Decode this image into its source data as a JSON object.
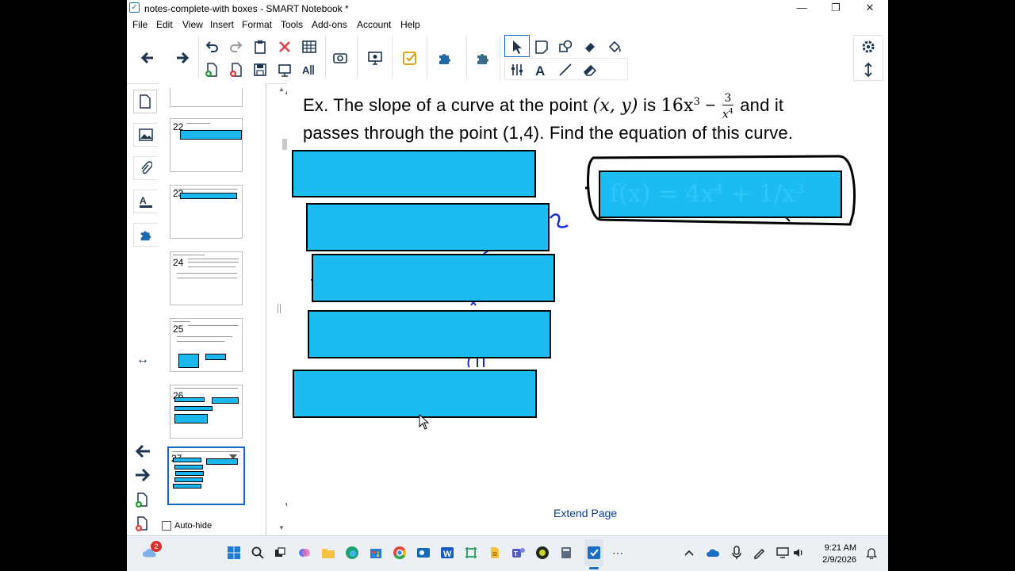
{
  "window": {
    "title": "notes-complete-with boxes - SMART Notebook *",
    "minimize": "—",
    "maximize": "❐",
    "close": "✕"
  },
  "menu": [
    "File",
    "Edit",
    "View",
    "Insert",
    "Format",
    "Tools",
    "Add-ons",
    "Account",
    "Help"
  ],
  "toolbar": {
    "icons": [
      "back-arrow-icon",
      "forward-arrow-icon",
      "undo-icon",
      "redo-icon",
      "delete-icon",
      "table-icon",
      "paste-icon",
      "add-page-icon",
      "delete-page-icon",
      "save-icon",
      "screen-shade-icon",
      "spell-check-icon",
      "screen-capture-icon",
      "document-camera-icon",
      "response-icon",
      "add-ons-icon",
      "puzzle-icon",
      "select-icon",
      "pen-icon",
      "shapes-icon",
      "eraser-fill-icon",
      "fill-icon",
      "measurement-icon",
      "text-icon",
      "line-icon",
      "eraser-icon",
      "settings-icon",
      "move-toolbar-icon"
    ]
  },
  "sidebar": {
    "tabs": [
      "page-sorter-icon",
      "gallery-icon",
      "attachments-icon",
      "properties-icon",
      "add-ons-icon"
    ],
    "thumbnails": [
      {
        "number": "22"
      },
      {
        "number": "23"
      },
      {
        "number": "24"
      },
      {
        "number": "25"
      },
      {
        "number": "26"
      },
      {
        "number": "27"
      }
    ],
    "auto_hide_label": "Auto-hide",
    "auto_hide_checked": false
  },
  "page": {
    "line1_prefix": "Ex. The slope of a curve at the point ",
    "line1_point": "(x, y)",
    "line1_is": " is ",
    "line1_expr": "16x",
    "line1_exp": "3",
    "line1_minus": " − ",
    "frac_num": "3",
    "frac_den": "x",
    "frac_den_exp": "4",
    "line1_suffix": " and it",
    "line2": "passes through the point (1,4).  Find the equation of this curve.",
    "handwriting": "f(x) = 4x⁴ + 1/x³",
    "extend_label": "Extend Page"
  },
  "taskbar": {
    "weather_badge": "2",
    "time": "9:21 AM",
    "date": "2/9/2026"
  },
  "colors": {
    "box_fill": "#1bbcf2",
    "accent": "#1469c7",
    "ink": "#1a2fd0"
  }
}
